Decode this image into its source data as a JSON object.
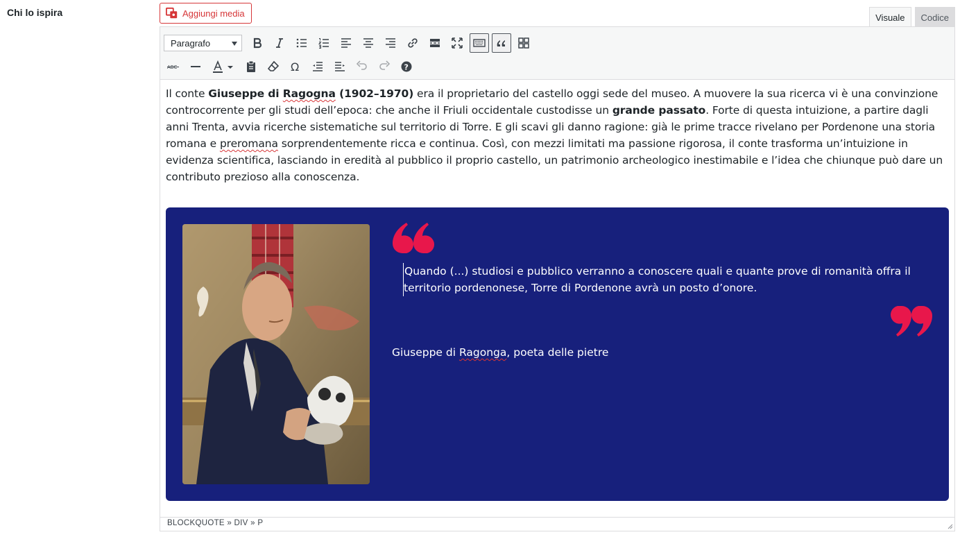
{
  "field_label": "Chi lo ispira",
  "add_media_label": "Aggiungi media",
  "tabs": {
    "visual": "Visuale",
    "code": "Codice"
  },
  "toolbar": {
    "format_select": "Paragrafo",
    "row1_icons": [
      "bold-icon",
      "italic-icon",
      "bullet-list-icon",
      "numbered-list-icon",
      "align-left-icon",
      "align-center-icon",
      "align-right-icon",
      "link-icon",
      "read-more-icon",
      "fullscreen-icon",
      "toolbar-toggle-icon",
      "blockquote-icon",
      "grid-icon"
    ],
    "row2_icons": [
      "strikethrough-icon",
      "horizontal-line-icon",
      "text-color-icon",
      "paste-text-icon",
      "clear-formatting-icon",
      "special-character-icon",
      "outdent-icon",
      "indent-icon",
      "undo-icon",
      "redo-icon",
      "help-icon"
    ]
  },
  "content": {
    "p1_a": "Il conte ",
    "p1_name": "Giuseppe di ",
    "p1_name_sq": "Ragogna",
    "p1_years": " (1902–1970)",
    "p1_b": " era il proprietario del castello oggi sede del museo. A muovere la sua ricerca vi è una convinzione controcorrente per gli studi dell’epoca: che anche il Friuli occidentale custodisse un ",
    "p1_bold2": "grande passato",
    "p1_c": ". Forte di questa intuizione, a partire dagli anni Trenta, avvia ricerche sistematiche sul territorio di Torre. E gli scavi gli danno ragione: già le prime tracce rivelano per Pordenone una storia romana e ",
    "p1_sq2": "preromana",
    "p1_d": " sorprendentemente ricca e continua. Così, con mezzi limitati ma passione rigorosa, il conte trasforma un’intuizione in evidenza scientifica, lasciando in eredità al pubblico il proprio castello, un patrimonio archeologico inestimabile e l’idea che chiunque può dare un contributo prezioso alla conoscenza."
  },
  "quote": {
    "text": "Quando (...) studiosi e pubblico verranno a conoscere quali e quante prove di romanità offra il territorio pordenonese, Torre di Pordenone avrà un posto d’onore.",
    "author_a": "Giuseppe di ",
    "author_sq": "Ragonga",
    "author_b": ", poeta delle pietre",
    "box_color": "#17207c",
    "quote_mark_color": "#e8174b"
  },
  "statusbar": {
    "path": "BLOCKQUOTE » DIV » P"
  }
}
